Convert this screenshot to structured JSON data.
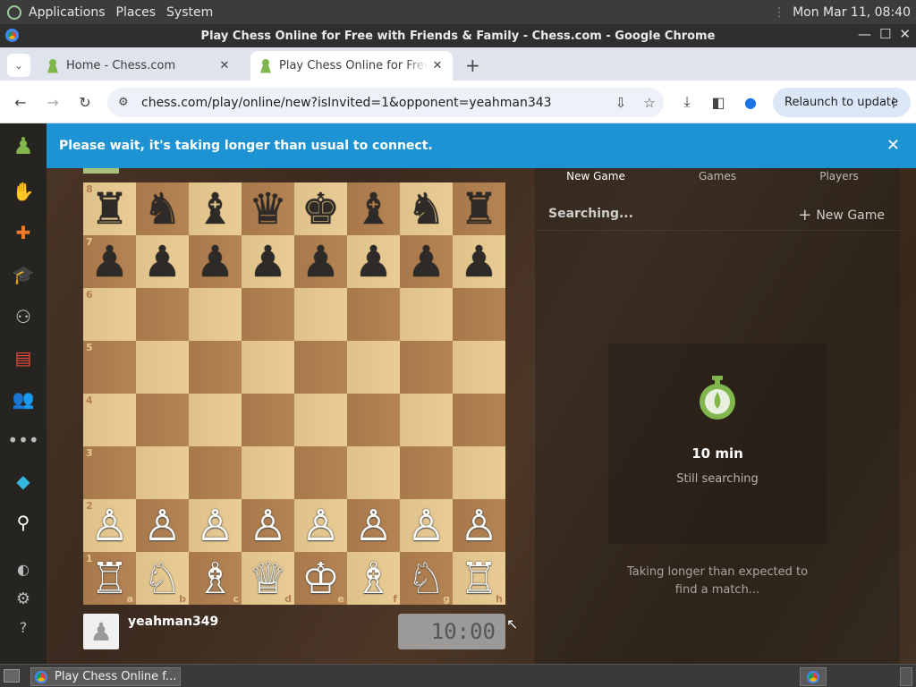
{
  "os_panel": {
    "menus": [
      "Applications",
      "Places",
      "System"
    ],
    "clock": "Mon Mar 11, 08:40"
  },
  "window": {
    "title": "Play Chess Online for Free with Friends & Family - Chess.com - Google Chrome"
  },
  "tabs": [
    {
      "title": "Home - Chess.com",
      "active": false
    },
    {
      "title": "Play Chess Online for Free with Friends & Family - Chess.com",
      "active": true
    }
  ],
  "toolbar": {
    "url": "chess.com/play/online/new?isInvited=1&opponent=yeahman343",
    "relaunch_label": "Relaunch to update"
  },
  "banner": {
    "message": "Please wait, it's taking longer than usual to connect."
  },
  "board": {
    "ranks": [
      "8",
      "7",
      "6",
      "5",
      "4",
      "3",
      "2",
      "1"
    ],
    "files": [
      "a",
      "b",
      "c",
      "d",
      "e",
      "f",
      "g",
      "h"
    ],
    "position": [
      [
        "♜",
        "♞",
        "♝",
        "♛",
        "♚",
        "♝",
        "♞",
        "♜"
      ],
      [
        "♟",
        "♟",
        "♟",
        "♟",
        "♟",
        "♟",
        "♟",
        "♟"
      ],
      [
        "",
        "",
        "",
        "",
        "",
        "",
        "",
        ""
      ],
      [
        "",
        "",
        "",
        "",
        "",
        "",
        "",
        ""
      ],
      [
        "",
        "",
        "",
        "",
        "",
        "",
        "",
        ""
      ],
      [
        "",
        "",
        "",
        "",
        "",
        "",
        "",
        ""
      ],
      [
        "♙",
        "♙",
        "♙",
        "♙",
        "♙",
        "♙",
        "♙",
        "♙"
      ],
      [
        "♖",
        "♘",
        "♗",
        "♕",
        "♔",
        "♗",
        "♘",
        "♖"
      ]
    ],
    "colors": {
      "light": "#e8c98f",
      "dark": "#b2804f"
    }
  },
  "player": {
    "name": "yeahman349",
    "clock": "10:00"
  },
  "side_panel": {
    "tabs": [
      "New Game",
      "Games",
      "Players"
    ],
    "status": "Searching...",
    "new_game_label": "New Game",
    "time_control": "10 min",
    "still_searching": "Still searching",
    "longer_message": "Taking longer than expected to find a match..."
  },
  "taskbar": {
    "window_button": "Play Chess Online f..."
  },
  "icons": {
    "nav": [
      "chess-logo-icon",
      "play-icon",
      "puzzles-icon",
      "learn-icon",
      "watch-icon",
      "news-icon",
      "social-icon",
      "more-icon",
      "premium-icon",
      "search-icon",
      "theme-icon",
      "settings-icon",
      "help-icon"
    ]
  }
}
